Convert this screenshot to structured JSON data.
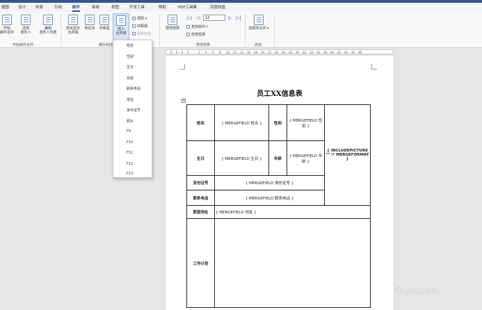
{
  "menu": {
    "tabs": [
      "插图",
      "设计",
      "布局",
      "引用",
      "邮件",
      "审阅",
      "视图",
      "开发工具",
      "帮助",
      "PDF工具集",
      "百度网盘"
    ]
  },
  "ribbon": {
    "start_merge": "开始\n邮件合并",
    "select_recipients": "选择\n收件人",
    "edit_recipients": "编辑\n收件人列表",
    "group_start": "开始邮件合并",
    "highlight_fields": "突出显示\n合并域",
    "address_block": "地址块",
    "greeting_line": "问候语",
    "insert_merge_field": "插入\n合并域",
    "rules": "规则",
    "match_fields": "匹配域",
    "update_labels": "更新标签",
    "group_write": "编写和插",
    "preview_results": "预览结果",
    "record_number": "12",
    "find_recipient": "查找收件人",
    "check_errors": "检查错误",
    "group_preview": "预览结果",
    "finish_merge": "完成并合并",
    "group_finish": "完成"
  },
  "field_menu": {
    "items": [
      "姓名",
      "性别",
      "生日",
      "年龄",
      "联系电话",
      "地址",
      "身份证号",
      "照片",
      "F9",
      "F10",
      "F11",
      "F12",
      "F13"
    ]
  },
  "ruler": {
    "ticks": [
      "8",
      "6",
      "4",
      "2",
      "2",
      "4",
      "6",
      "8",
      "10",
      "12",
      "14",
      "16",
      "18",
      "20",
      "22",
      "24",
      "26",
      "28",
      "30",
      "32",
      "34",
      "36",
      "38",
      "40",
      "42",
      "44",
      "46",
      "48"
    ]
  },
  "document": {
    "title": "员工XX信息表",
    "labels": {
      "name": "姓名",
      "gender": "性别",
      "birthday": "生日",
      "age": "年龄",
      "id_number": "身份证号",
      "phone": "联系电话",
      "address": "家庭地址",
      "work_plan": "工作计划"
    },
    "fields": {
      "name": "{ MERGEFIELD 姓名 }",
      "gender": "{ MERGEFIELD 性别 }",
      "birthday": "{ MERGEFIELD 生日 }",
      "age": "{ MERGEFIELD 年龄 }",
      "photo": "{ INCLUDEPICTURE \"\" \\* MERGEFORMAT }",
      "id_number": "{ MERGEFIELD 身份证号 }",
      "phone": "{ MERGEFIELD 联系电话 }",
      "address": "{ MERGEFIELD 地址 }"
    }
  },
  "watermark": "@地瓜说机"
}
